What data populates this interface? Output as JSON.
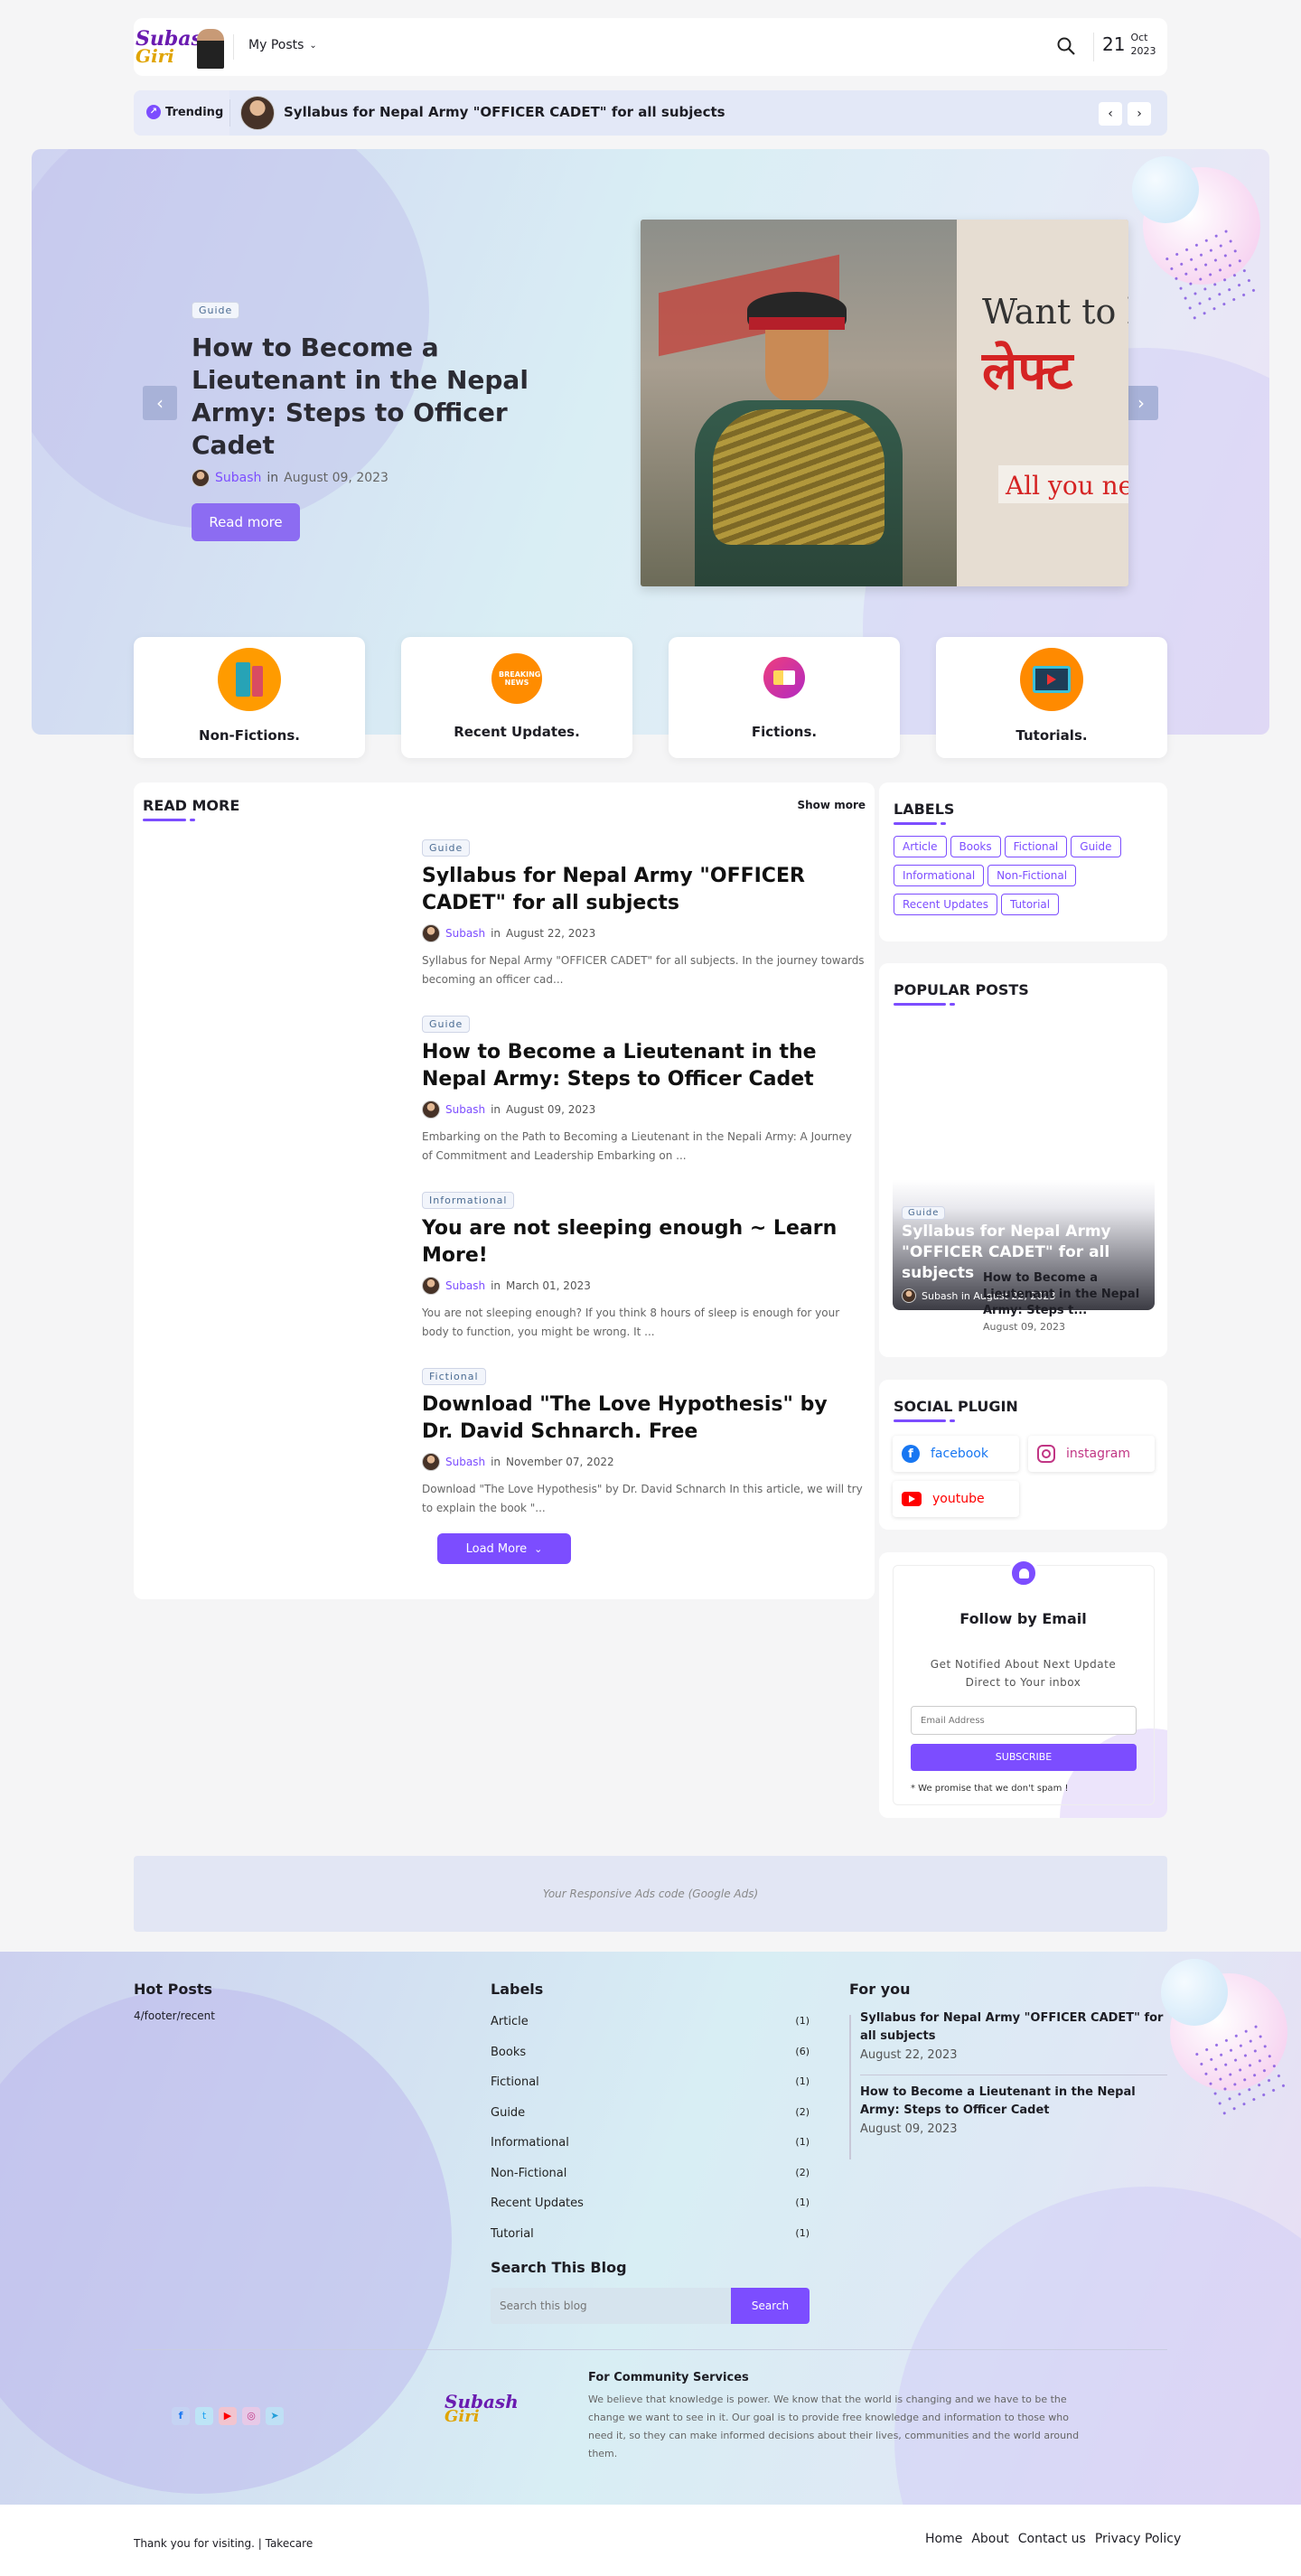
{
  "header": {
    "logo_top": "Subash",
    "logo_bottom": "Giri",
    "menu": "My Posts",
    "date_day": "21",
    "date_month": "Oct",
    "date_year": "2023"
  },
  "trending": {
    "label": "Trending",
    "title": "Syllabus for Nepal Army \"OFFICER CADET\" for all subjects"
  },
  "hero": {
    "tag": "Guide",
    "title": "How to Become a Lieutenant in the Nepal Army: Steps to Officer Cadet",
    "author": "Subash",
    "in": "in",
    "date": "August 09, 2023",
    "button": "Read more",
    "img_line1": "Want to b",
    "img_line2": "लेफ्ट",
    "img_line3": "All you nee"
  },
  "categories": [
    {
      "label": "Non-Fictions."
    },
    {
      "label": "Recent Updates.",
      "badge": "BREAKING NEWS"
    },
    {
      "label": "Fictions."
    },
    {
      "label": "Tutorials."
    }
  ],
  "read_more": {
    "title": "READ MORE",
    "show_more": "Show more",
    "load_more": "Load More",
    "posts": [
      {
        "tag": "Guide",
        "title": "Syllabus for Nepal Army \"OFFICER CADET\" for all subjects",
        "author": "Subash",
        "in": "in",
        "date": "August 22, 2023",
        "excerpt": "Syllabus for Nepal Army  \"OFFICER CADET\" for all subjects.     In the journey towards becoming an officer cad..."
      },
      {
        "tag": "Guide",
        "title": "How to Become a Lieutenant in the Nepal Army: Steps to Officer Cadet",
        "author": "Subash",
        "in": "in",
        "date": "August 09, 2023",
        "excerpt": "Embarking on the Path to Becoming a Lieutenant in the Nepali Army: A Journey of Commitment and Leadership Embarking on ..."
      },
      {
        "tag": "Informational",
        "title": "You are not sleeping enough ~ Learn More!",
        "author": "Subash",
        "in": "in",
        "date": "March 01, 2023",
        "excerpt": "You are not sleeping enough? If you think 8 hours of sleep is enough for your body to function, you might be wrong. It ..."
      },
      {
        "tag": "Fictional",
        "title": "Download \"The Love Hypothesis\" by Dr. David Schnarch. Free",
        "author": "Subash",
        "in": "in",
        "date": "November 07, 2022",
        "excerpt": "Download \"The Love Hypothesis\" by Dr. David Schnarch  In this article, we will try to explain the book \"..."
      }
    ]
  },
  "labels": {
    "title": "LABELS",
    "items": [
      "Article",
      "Books",
      "Fictional",
      "Guide",
      "Informational",
      "Non-Fictional",
      "Recent Updates",
      "Tutorial"
    ]
  },
  "popular": {
    "title": "POPULAR POSTS",
    "featured": {
      "tag": "Guide",
      "title": "Syllabus for Nepal Army \"OFFICER CADET\" for all subjects",
      "meta": "Subash in August 22, 2023"
    },
    "item": {
      "title": "How to Become a Lieutenant in the Nepal Army: Steps t...",
      "date": "August 09, 2023"
    }
  },
  "social": {
    "title": "SOCIAL PLUGIN",
    "facebook": "facebook",
    "instagram": "instagram",
    "youtube": "youtube"
  },
  "follow": {
    "title": "Follow by Email",
    "desc": "Get Notified About Next Update Direct to Your inbox",
    "placeholder": "Email Address",
    "button": "SUBSCRIBE",
    "note": "* We promise that we don't spam !"
  },
  "ads": "Your Responsive Ads code (Google Ads)",
  "footer": {
    "hot_title": "Hot Posts",
    "hot_text": "4/footer/recent",
    "labels_title": "Labels",
    "labels": [
      {
        "name": "Article",
        "count": "(1)"
      },
      {
        "name": "Books",
        "count": "(6)"
      },
      {
        "name": "Fictional",
        "count": "(1)"
      },
      {
        "name": "Guide",
        "count": "(2)"
      },
      {
        "name": "Informational",
        "count": "(1)"
      },
      {
        "name": "Non-Fictional",
        "count": "(2)"
      },
      {
        "name": "Recent Updates",
        "count": "(1)"
      },
      {
        "name": "Tutorial",
        "count": "(1)"
      }
    ],
    "search_title": "Search This Blog",
    "search_placeholder": "Search this blog",
    "search_button": "Search",
    "foryou_title": "For you",
    "foryou": [
      {
        "title": "Syllabus for Nepal Army \"OFFICER CADET\" for all subjects",
        "date": "August 22, 2023"
      },
      {
        "title": "How to Become a Lieutenant in the Nepal Army: Steps to Officer Cadet",
        "date": "August 09, 2023"
      }
    ],
    "community_title": "For Community Services",
    "community_text": "We believe that knowledge is power. We know that the world is changing and we have to be the change we want to see in it. Our goal is to provide free knowledge and information to those who need it, so they can make informed decisions about their lives, communities and the world around them.",
    "bottom_text": "Thank you for visiting. | Takecare",
    "links": [
      "Home",
      "About",
      "Contact us",
      "Privacy Policy"
    ]
  },
  "colors": {
    "accent": "#7c4dff",
    "youtube": "#ff0000",
    "instagram": "#c13584",
    "facebook": "#1877f2"
  }
}
